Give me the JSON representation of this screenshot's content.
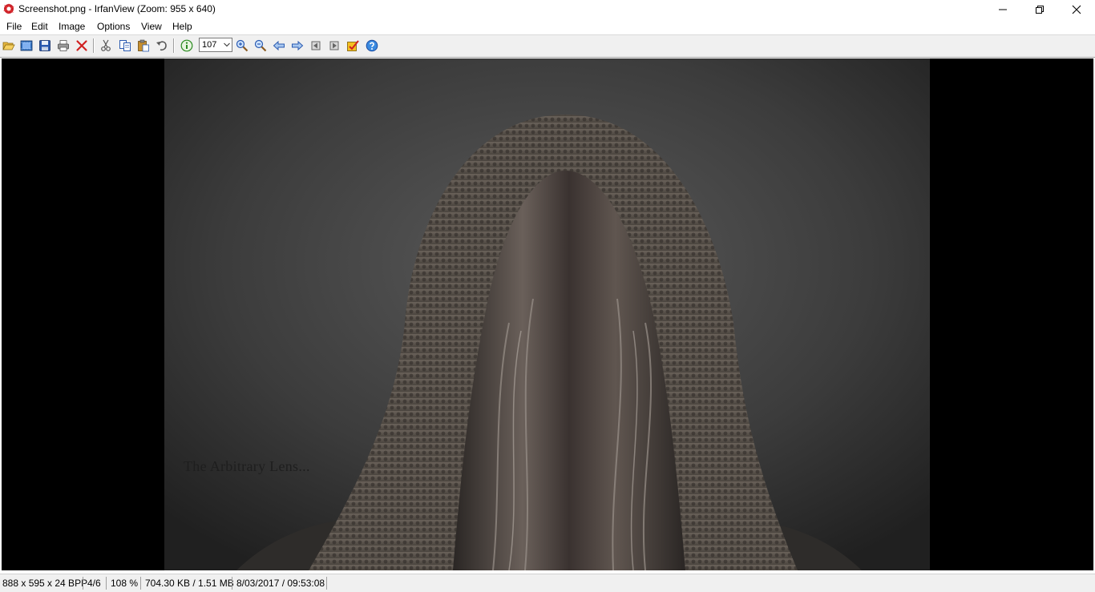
{
  "window": {
    "title": "Screenshot.png - IrfanView (Zoom: 955 x 640)"
  },
  "menu": [
    "File",
    "Edit",
    "Image",
    "Options",
    "View",
    "Help"
  ],
  "toolbar": {
    "zoom_value": "107",
    "icons": [
      "open-icon",
      "thumbnails-icon",
      "save-icon",
      "print-icon",
      "delete-icon",
      "cut-icon",
      "copy-icon",
      "paste-icon",
      "undo-icon",
      "info-icon",
      "zoom-in-icon",
      "zoom-out-icon",
      "previous-icon",
      "next-icon",
      "first-icon",
      "last-icon",
      "options-icon",
      "help-icon"
    ]
  },
  "viewer": {
    "watermark": "The Arbitrary Lens..."
  },
  "status": {
    "dimensions": "888 x 595 x 24 BPP",
    "index": "4/6",
    "zoom": "108 %",
    "size": "704.30 KB / 1.51 MB",
    "datetime": "8/03/2017 / 09:53:08"
  },
  "colors": {
    "accent": "#cc2222",
    "viewer_bg": "#000000",
    "toolbar_bg": "#f0f0f0"
  }
}
